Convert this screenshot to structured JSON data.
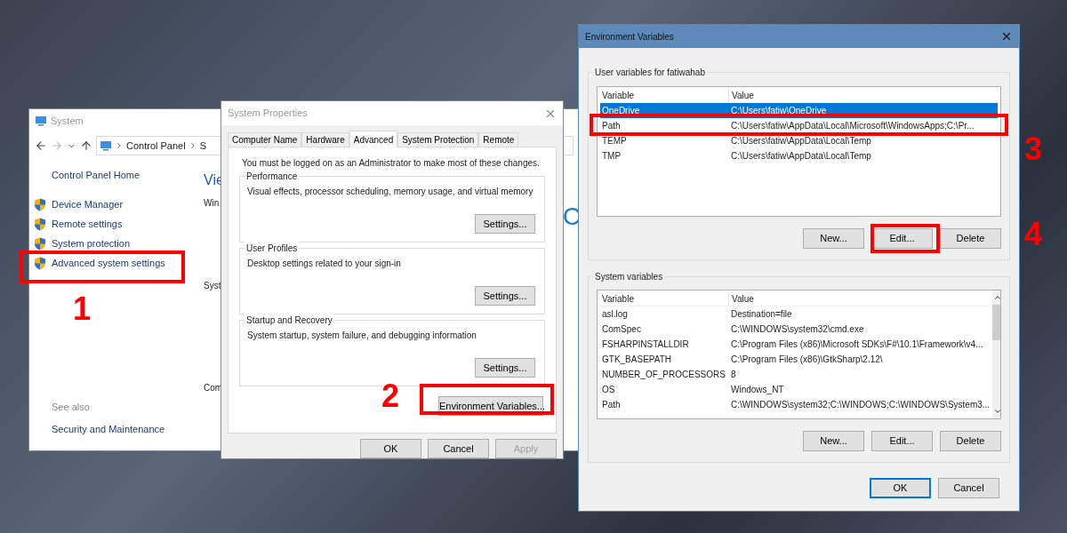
{
  "system_window": {
    "title": "System",
    "breadcrumb": [
      "Control Panel",
      "S"
    ],
    "home_link": "Control Panel Home",
    "links": [
      "Device Manager",
      "Remote settings",
      "System protection",
      "Advanced system settings"
    ],
    "see_also": "See also",
    "see_also_links": [
      "Security and Maintenance"
    ],
    "heading_fragment": "Vie",
    "section_fragments": [
      "Win",
      "Syst",
      "Com"
    ],
    "edge_fragment": "C"
  },
  "system_properties": {
    "title": "System Properties",
    "tabs": [
      {
        "label": "Computer Name",
        "selected": false
      },
      {
        "label": "Hardware",
        "selected": false
      },
      {
        "label": "Advanced",
        "selected": true
      },
      {
        "label": "System Protection",
        "selected": false
      },
      {
        "label": "Remote",
        "selected": false
      }
    ],
    "notice": "You must be logged on as an Administrator to make most of these changes.",
    "groups": [
      {
        "title": "Performance",
        "description": "Visual effects, processor scheduling, memory usage, and virtual memory",
        "button": "Settings..."
      },
      {
        "title": "User Profiles",
        "description": "Desktop settings related to your sign-in",
        "button": "Settings..."
      },
      {
        "title": "Startup and Recovery",
        "description": "System startup, system failure, and debugging information",
        "button": "Settings..."
      }
    ],
    "env_button": "Environment Variables...",
    "footer_buttons": [
      {
        "label": "OK",
        "disabled": false
      },
      {
        "label": "Cancel",
        "disabled": false
      },
      {
        "label": "Apply",
        "disabled": true
      }
    ]
  },
  "environment_variables": {
    "title": "Environment Variables",
    "sections": [
      {
        "title": "User variables for fatiwahab",
        "columns": [
          "Variable",
          "Value"
        ],
        "rows": [
          {
            "variable": "OneDrive",
            "value": "C:\\Users\\fatiw\\OneDrive",
            "selected": true
          },
          {
            "variable": "Path",
            "value": "C:\\Users\\fatiw\\AppData\\Local\\Microsoft\\WindowsApps;C:\\Pr...",
            "selected": false
          },
          {
            "variable": "TEMP",
            "value": "C:\\Users\\fatiw\\AppData\\Local\\Temp",
            "selected": false
          },
          {
            "variable": "TMP",
            "value": "C:\\Users\\fatiw\\AppData\\Local\\Temp",
            "selected": false
          }
        ],
        "buttons": [
          "New...",
          "Edit...",
          "Delete"
        ]
      },
      {
        "title": "System variables",
        "columns": [
          "Variable",
          "Value"
        ],
        "rows": [
          {
            "variable": "asl.log",
            "value": "Destination=file",
            "selected": false
          },
          {
            "variable": "ComSpec",
            "value": "C:\\WINDOWS\\system32\\cmd.exe",
            "selected": false
          },
          {
            "variable": "FSHARPINSTALLDIR",
            "value": "C:\\Program Files (x86)\\Microsoft SDKs\\F#\\10.1\\Framework\\v4...",
            "selected": false
          },
          {
            "variable": "GTK_BASEPATH",
            "value": "C:\\Program Files (x86)\\GtkSharp\\2.12\\",
            "selected": false
          },
          {
            "variable": "NUMBER_OF_PROCESSORS",
            "value": "8",
            "selected": false
          },
          {
            "variable": "OS",
            "value": "Windows_NT",
            "selected": false
          },
          {
            "variable": "Path",
            "value": "C:\\WINDOWS\\system32;C:\\WINDOWS;C:\\WINDOWS\\System3...",
            "selected": false
          }
        ],
        "buttons": [
          "New...",
          "Edit...",
          "Delete"
        ]
      }
    ],
    "footer_buttons": [
      "OK",
      "Cancel"
    ]
  },
  "annotations": [
    {
      "label": "1"
    },
    {
      "label": "2"
    },
    {
      "label": "3"
    },
    {
      "label": "4"
    }
  ]
}
